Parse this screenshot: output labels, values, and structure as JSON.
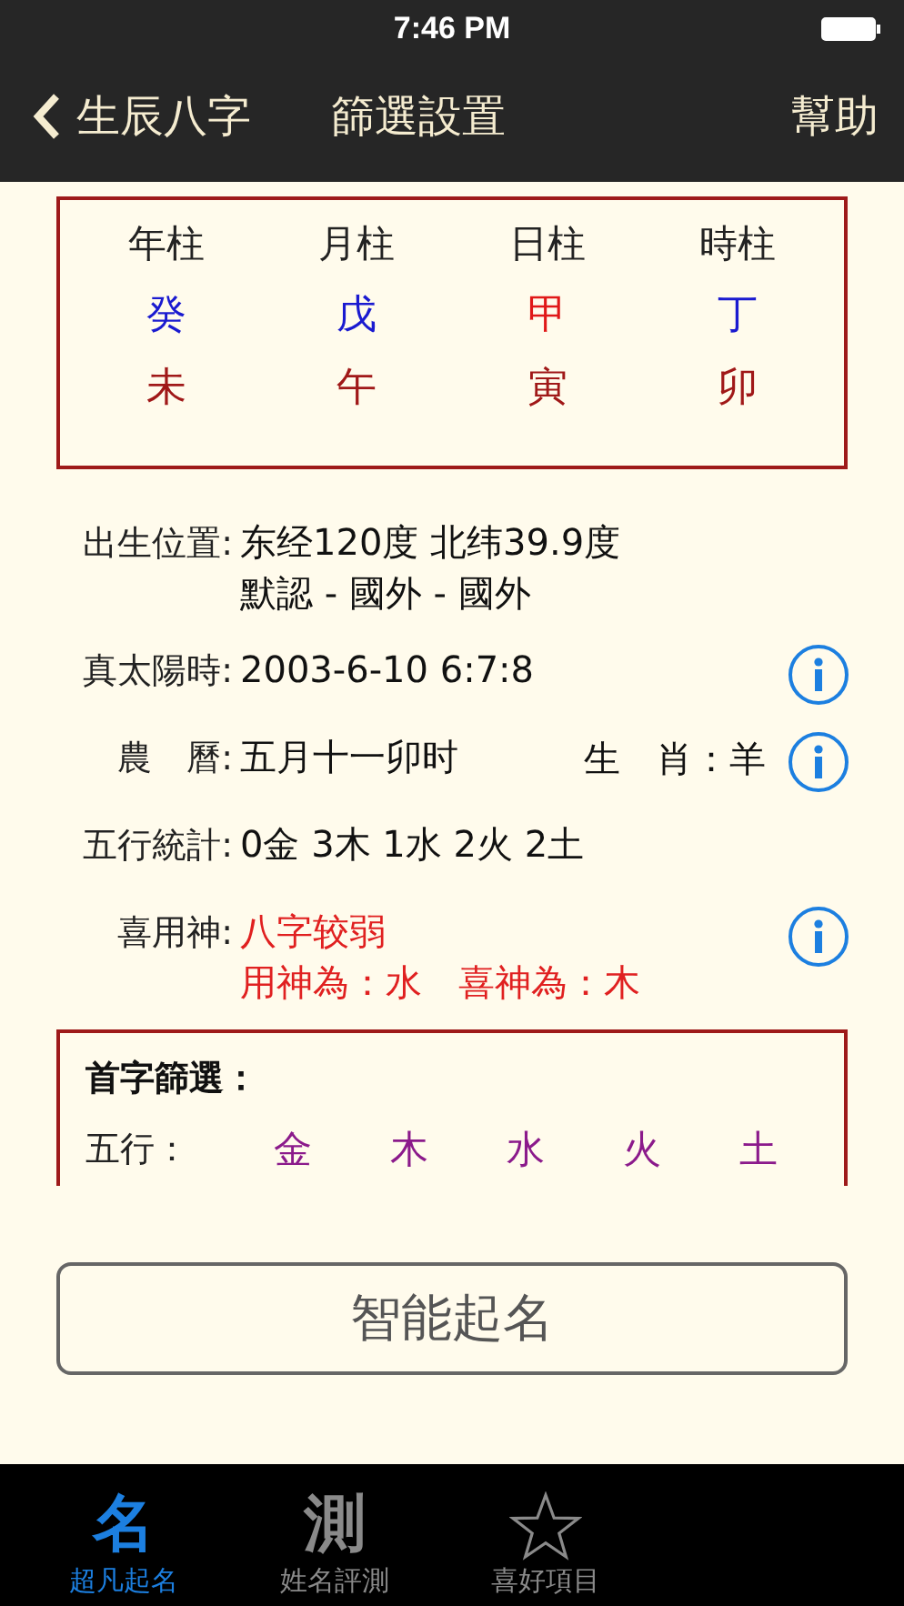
{
  "status_bar": {
    "time": "7:46 PM"
  },
  "nav": {
    "back": "生辰八字",
    "title": "篩選設置",
    "action": "幫助"
  },
  "pillars": [
    {
      "header": "年柱",
      "stem": {
        "text": "癸",
        "color": "#1a1ad0"
      },
      "branch": {
        "text": "未",
        "color": "#a01818"
      }
    },
    {
      "header": "月柱",
      "stem": {
        "text": "戊",
        "color": "#1a1ad0"
      },
      "branch": {
        "text": "午",
        "color": "#a01818"
      }
    },
    {
      "header": "日柱",
      "stem": {
        "text": "甲",
        "color": "#e01818"
      },
      "branch": {
        "text": "寅",
        "color": "#a01818"
      }
    },
    {
      "header": "時柱",
      "stem": {
        "text": "丁",
        "color": "#1a1ad0"
      },
      "branch": {
        "text": "卯",
        "color": "#a01818"
      }
    }
  ],
  "info_rows": [
    {
      "label": "出生位置:",
      "lines": [
        "东经120度 北纬39.9度",
        "默認 - 國外 - 國外"
      ],
      "extra": null,
      "highlight": false,
      "info": false
    },
    {
      "label": "真太陽時:",
      "lines": [
        "2003-6-10 6:7:8"
      ],
      "extra": null,
      "highlight": false,
      "info": true
    },
    {
      "label": "農　曆:",
      "lines": [
        "五月十一卯时"
      ],
      "extra": "生　肖：羊",
      "highlight": false,
      "info": true
    },
    {
      "label": "五行統計:",
      "lines": [
        "0金 3木 1水 2火 2土"
      ],
      "extra": null,
      "highlight": false,
      "info": false
    },
    {
      "label": "喜用神:",
      "lines": [
        "八字较弱",
        "用神為：水　喜神為：木"
      ],
      "extra": null,
      "highlight": true,
      "info": true
    }
  ],
  "filter": {
    "title": "首字篩選：",
    "element_label": "五行：",
    "elements": [
      "金",
      "木",
      "水",
      "火",
      "土"
    ]
  },
  "button": "智能起名",
  "tabs": [
    {
      "kind": "glyph",
      "glyph": "名",
      "label": "超凡起名",
      "selected": true
    },
    {
      "kind": "glyph",
      "glyph": "測",
      "label": "姓名評測",
      "selected": false
    },
    {
      "kind": "star",
      "label": "喜好項目",
      "selected": false
    }
  ]
}
